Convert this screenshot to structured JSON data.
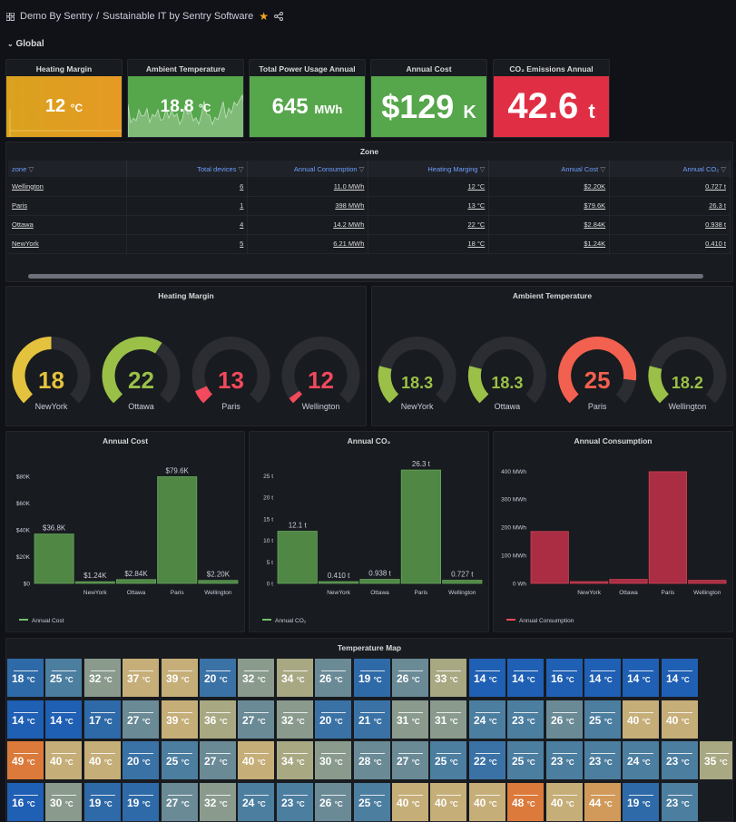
{
  "header": {
    "org": "Demo By Sentry",
    "sep": "/",
    "title": "Sustainable IT by Sentry Software",
    "row_label": "Global"
  },
  "stats": [
    {
      "title": "Heating Margin",
      "value": "12",
      "unit": "°C",
      "bg": "#d29a1f",
      "bg2": "#e0a12a"
    },
    {
      "title": "Ambient Temperature",
      "value": "18.8",
      "unit": "°C",
      "bg": "#56a64b",
      "bg2": "#56a64b"
    },
    {
      "title": "Total Power Usage Annual",
      "value": "645",
      "unit": "MWh",
      "bg": "#56a64b",
      "bg2": "#56a64b"
    },
    {
      "title": "Annual Cost",
      "value": "$129",
      "unit": "K",
      "bg": "#56a64b",
      "bg2": "#56a64b"
    },
    {
      "title": "CO₂ Emissions Annual",
      "value": "42.6",
      "unit": "t",
      "bg": "#e02f44",
      "bg2": "#e02f44"
    }
  ],
  "zone_table": {
    "title": "Zone",
    "columns": [
      "zone",
      "Total devices",
      "Annual Consumption",
      "Heating Marging",
      "Annual Cost",
      "Annual CO₂"
    ],
    "rows": [
      [
        "Wellington",
        "6",
        "11.0 MWh",
        "12 °C",
        "$2.20K",
        "0.727 t"
      ],
      [
        "Paris",
        "1",
        "398 MWh",
        "13 °C",
        "$79.6K",
        "26.3 t"
      ],
      [
        "Ottawa",
        "4",
        "14.2 MWh",
        "22 °C",
        "$2.84K",
        "0.938 t"
      ],
      [
        "NewYork",
        "5",
        "6.21 MWh",
        "18 °C",
        "$1.24K",
        "0.410 t"
      ]
    ]
  },
  "heating_gauges": {
    "title": "Heating Margin",
    "items": [
      {
        "name": "NewYork",
        "value": "18",
        "fraction": 0.5,
        "color": "#e5c23d"
      },
      {
        "name": "Ottawa",
        "value": "22",
        "fraction": 0.62,
        "color": "#9ac048"
      },
      {
        "name": "Paris",
        "value": "13",
        "fraction": 0.08,
        "color": "#f2495c"
      },
      {
        "name": "Wellington",
        "value": "12",
        "fraction": 0.0,
        "color": "#f2495c"
      }
    ]
  },
  "ambient_gauges": {
    "title": "Ambient Temperature",
    "items": [
      {
        "name": "NewYork",
        "value": "18.3",
        "fraction": 0.22,
        "color": "#9ac048"
      },
      {
        "name": "Ottawa",
        "value": "18.3",
        "fraction": 0.22,
        "color": "#9ac048"
      },
      {
        "name": "Paris",
        "value": "25",
        "fraction": 0.86,
        "color": "#f2604f"
      },
      {
        "name": "Wellington",
        "value": "18.2",
        "fraction": 0.22,
        "color": "#9ac048"
      }
    ]
  },
  "chart_data": [
    {
      "type": "bar",
      "title": "Annual Cost",
      "categories": [
        "",
        "NewYork",
        "Ottawa",
        "Paris",
        "Wellington"
      ],
      "values": [
        36.8,
        1.24,
        2.84,
        79.6,
        2.2
      ],
      "value_labels": [
        "$36.8K",
        "$1.24K",
        "$2.84K",
        "$79.6K",
        "$2.20K"
      ],
      "ylim": [
        0,
        90
      ],
      "yticks": [
        0,
        20,
        40,
        60,
        80
      ],
      "ytick_labels": [
        "$0",
        "$20K",
        "$40K",
        "$60K",
        "$80K"
      ],
      "series_name": "Annual Cost",
      "color": "#73bf69",
      "fill": "#5a9a4c",
      "grid": false,
      "legend": "bottom-left"
    },
    {
      "type": "bar",
      "title": "Annual CO₂",
      "categories": [
        "",
        "NewYork",
        "Ottawa",
        "Paris",
        "Wellington"
      ],
      "values": [
        12.1,
        0.41,
        0.938,
        26.3,
        0.727
      ],
      "value_labels": [
        "12.1 t",
        "0.410 t",
        "0.938 t",
        "26.3 t",
        "0.727 t"
      ],
      "ylim": [
        0,
        28
      ],
      "yticks": [
        0,
        5,
        10,
        15,
        20,
        25
      ],
      "ytick_labels": [
        "0 t",
        "5 t",
        "10 t",
        "15 t",
        "20 t",
        "25 t"
      ],
      "series_name": "Annual CO₂",
      "color": "#73bf69",
      "fill": "#5a9a4c",
      "grid": false,
      "legend": "bottom-left"
    },
    {
      "type": "bar",
      "title": "Annual Consumption",
      "categories": [
        "",
        "NewYork",
        "Ottawa",
        "Paris",
        "Wellington"
      ],
      "values": [
        185,
        6.21,
        14.2,
        398,
        11.0
      ],
      "value_labels": [],
      "ylim": [
        0,
        430
      ],
      "yticks": [
        0,
        100,
        200,
        300,
        400
      ],
      "ytick_labels": [
        "0 Wh",
        "100 MWh",
        "200 MWh",
        "300 MWh",
        "400 MWh"
      ],
      "series_name": "Annual Consumption",
      "color": "#f2495c",
      "fill": "#c4314b",
      "grid": false,
      "legend": "bottom-left"
    }
  ],
  "temp_map": {
    "title": "Temperature Map",
    "unit": "°C",
    "rows": [
      [
        18,
        25,
        32,
        37,
        39,
        20,
        32,
        34,
        26,
        19,
        26,
        33,
        14,
        14,
        16,
        14,
        14,
        14
      ],
      [
        14,
        14,
        17,
        27,
        39,
        36,
        27,
        32,
        20,
        21,
        31,
        31,
        24,
        23,
        26,
        25,
        40,
        40
      ],
      [
        49,
        40,
        40,
        20,
        25,
        27,
        40,
        34,
        30,
        28,
        27,
        25,
        22,
        25,
        23,
        23,
        24,
        23,
        35
      ],
      [
        16,
        30,
        19,
        19,
        27,
        32,
        24,
        23,
        26,
        25,
        40,
        40,
        40,
        48,
        40,
        44,
        19,
        23
      ]
    ]
  }
}
